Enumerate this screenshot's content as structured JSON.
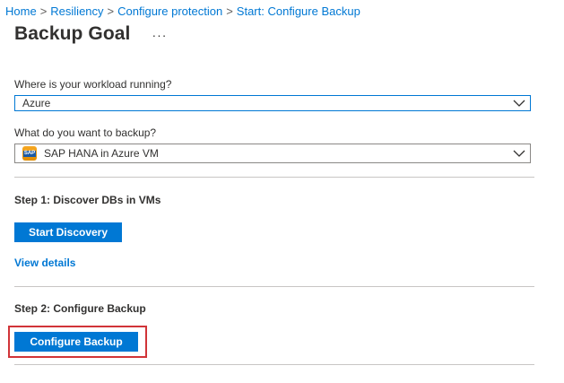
{
  "breadcrumb": {
    "items": [
      "Home",
      "Resiliency",
      "Configure protection",
      "Start: Configure Backup"
    ],
    "separator": ">"
  },
  "header": {
    "title": "Backup Goal",
    "more_label": "···"
  },
  "form": {
    "workload_label": "Where is your workload running?",
    "workload_value": "Azure",
    "backup_label": "What do you want to backup?",
    "backup_value": "SAP HANA in Azure VM",
    "backup_icon": "sap-icon",
    "sap_icon_text": "SAP"
  },
  "step1": {
    "title": "Step 1: Discover DBs in VMs",
    "button_label": "Start Discovery",
    "link_label": "View details"
  },
  "step2": {
    "title": "Step 2: Configure Backup",
    "button_label": "Configure Backup"
  },
  "colors": {
    "accent": "#0078d4",
    "highlight": "#d13438",
    "text": "#323130",
    "divider": "#c8c6c4"
  }
}
